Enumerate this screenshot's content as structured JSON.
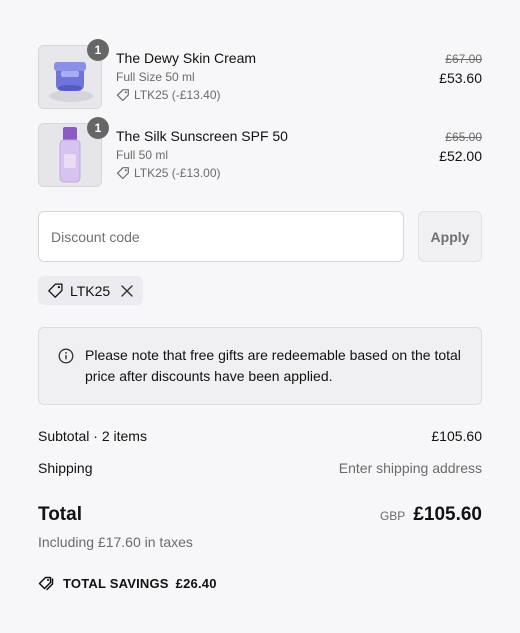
{
  "items": [
    {
      "name": "The Dewy Skin Cream",
      "variant": "Full Size 50 ml",
      "discount": "LTK25 (-£13.40)",
      "original_price": "£67.00",
      "price": "£53.60",
      "quantity": "1",
      "image_icon": "cream-jar-icon"
    },
    {
      "name": "The Silk Sunscreen SPF 50",
      "variant": "Full 50 ml",
      "discount": "LTK25 (-£13.00)",
      "original_price": "£65.00",
      "price": "£52.00",
      "quantity": "1",
      "image_icon": "sunscreen-bottle-icon"
    }
  ],
  "discount": {
    "placeholder": "Discount code",
    "apply_label": "Apply",
    "applied_code": "LTK25"
  },
  "notice": {
    "text": "Please note that free gifts are redeemable based on the total price after discounts have been applied."
  },
  "summary": {
    "subtotal_label": "Subtotal · 2 items",
    "subtotal_value": "£105.60",
    "shipping_label": "Shipping",
    "shipping_value": "Enter shipping address",
    "total_label": "Total",
    "currency": "GBP",
    "total_value": "£105.60",
    "taxes_text": "Including £17.60 in taxes",
    "savings_label": "TOTAL SAVINGS",
    "savings_value": "£26.40"
  },
  "colors": {
    "background": "#f7f7f9",
    "muted_text": "#6b6b6b",
    "qty_badge": "#666666",
    "cream_lid": "#6b6fd8",
    "sunscreen_bottle": "#c9b3e8"
  }
}
